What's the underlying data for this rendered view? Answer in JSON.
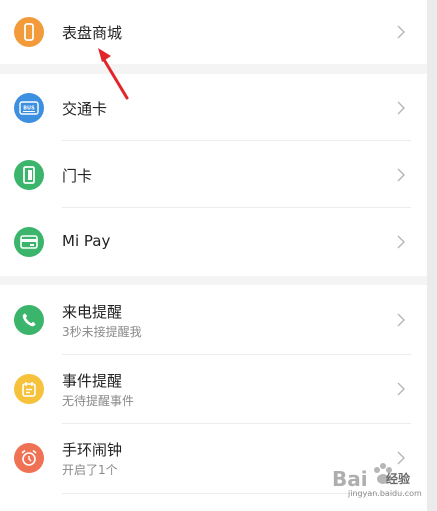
{
  "colors": {
    "orange": "#f39a3a",
    "blue": "#3d8fe0",
    "green": "#3bb56b",
    "yellow": "#f6c23b",
    "coral": "#f07254",
    "arrow": "#e0262a"
  },
  "section1": {
    "items": [
      {
        "title": "表盘商城",
        "icon": "watch-icon"
      }
    ]
  },
  "section2": {
    "items": [
      {
        "title": "交通卡",
        "icon": "bus-card-icon"
      },
      {
        "title": "门卡",
        "icon": "door-card-icon"
      },
      {
        "title": "Mi Pay",
        "icon": "wallet-icon"
      }
    ]
  },
  "section3": {
    "items": [
      {
        "title": "来电提醒",
        "subtitle": "3秒未接提醒我",
        "icon": "phone-icon"
      },
      {
        "title": "事件提醒",
        "subtitle": "无待提醒事件",
        "icon": "event-icon"
      },
      {
        "title": "手环闹钟",
        "subtitle": "开启了1个",
        "icon": "alarm-icon"
      }
    ]
  },
  "bus_label": "BUS",
  "watermark": {
    "text": "经验",
    "url": "jingyan.baidu.com"
  }
}
